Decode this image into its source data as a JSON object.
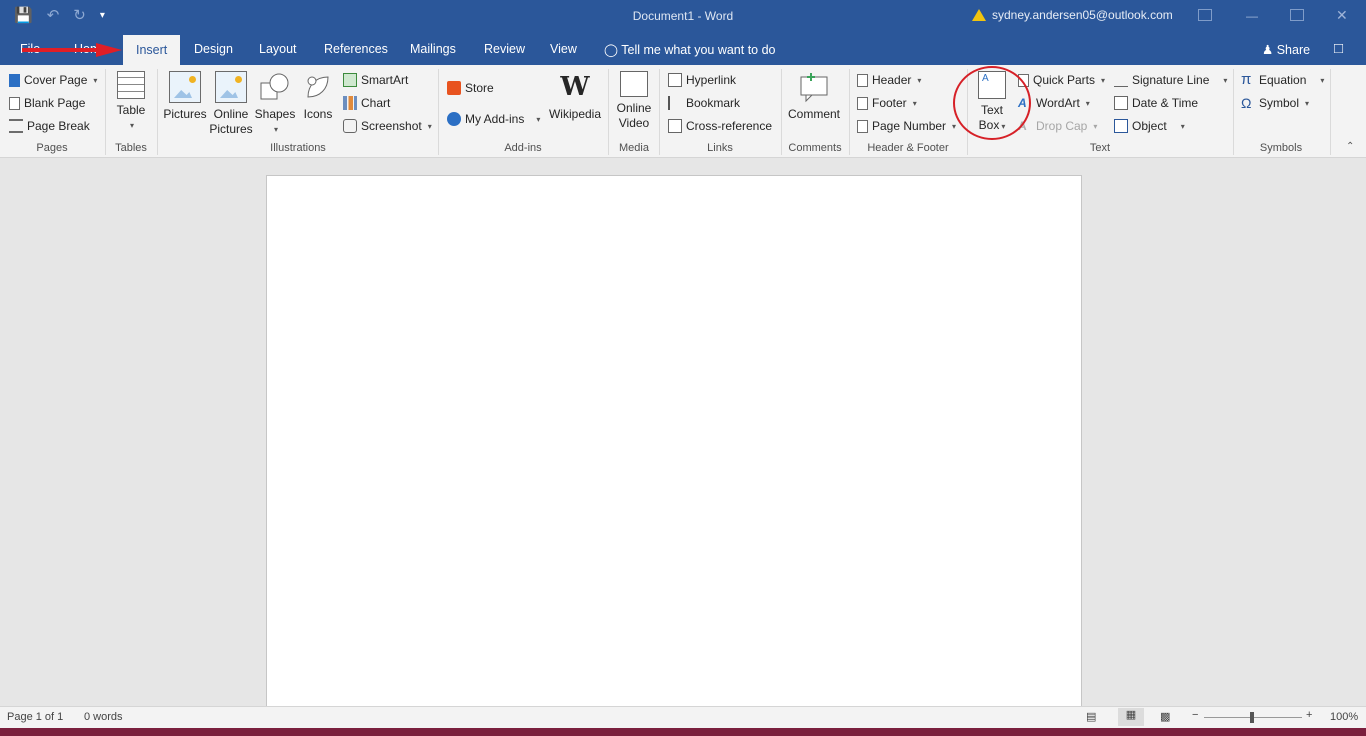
{
  "title_bar": {
    "document_title": "Document1 - Word",
    "user_email": "sydney.andersen05@outlook.com"
  },
  "tabs": [
    {
      "label": "File"
    },
    {
      "label": "Home"
    },
    {
      "label": "Insert"
    },
    {
      "label": "Design"
    },
    {
      "label": "Layout"
    },
    {
      "label": "References"
    },
    {
      "label": "Mailings"
    },
    {
      "label": "Review"
    },
    {
      "label": "View"
    }
  ],
  "tell_me": "Tell me what you want to do",
  "share_label": "Share",
  "ribbon": {
    "pages": {
      "label": "Pages",
      "cover_page": "Cover Page",
      "blank_page": "Blank Page",
      "page_break": "Page Break"
    },
    "tables": {
      "label": "Tables",
      "table": "Table"
    },
    "illustrations": {
      "label": "Illustrations",
      "pictures": "Pictures",
      "online_pictures_1": "Online",
      "online_pictures_2": "Pictures",
      "shapes": "Shapes",
      "icons": "Icons",
      "smartart": "SmartArt",
      "chart": "Chart",
      "screenshot": "Screenshot"
    },
    "addins": {
      "label": "Add-ins",
      "store": "Store",
      "my_addins": "My Add-ins",
      "wikipedia": "Wikipedia"
    },
    "media": {
      "label": "Media",
      "online_video_1": "Online",
      "online_video_2": "Video"
    },
    "links": {
      "label": "Links",
      "hyperlink": "Hyperlink",
      "bookmark": "Bookmark",
      "cross_reference": "Cross-reference"
    },
    "comments": {
      "label": "Comments",
      "comment": "Comment"
    },
    "header_footer": {
      "label": "Header & Footer",
      "header": "Header",
      "footer": "Footer",
      "page_number": "Page Number"
    },
    "text": {
      "label": "Text",
      "text_box_1": "Text",
      "text_box_2": "Box",
      "quick_parts": "Quick Parts",
      "wordart": "WordArt",
      "drop_cap": "Drop Cap",
      "signature_line": "Signature Line",
      "date_time": "Date & Time",
      "object": "Object"
    },
    "symbols": {
      "label": "Symbols",
      "equation": "Equation",
      "symbol": "Symbol"
    }
  },
  "status": {
    "page": "Page 1 of 1",
    "words": "0 words",
    "zoom": "100%"
  },
  "colors": {
    "accent": "#2b579a",
    "annotation": "#d62027"
  }
}
